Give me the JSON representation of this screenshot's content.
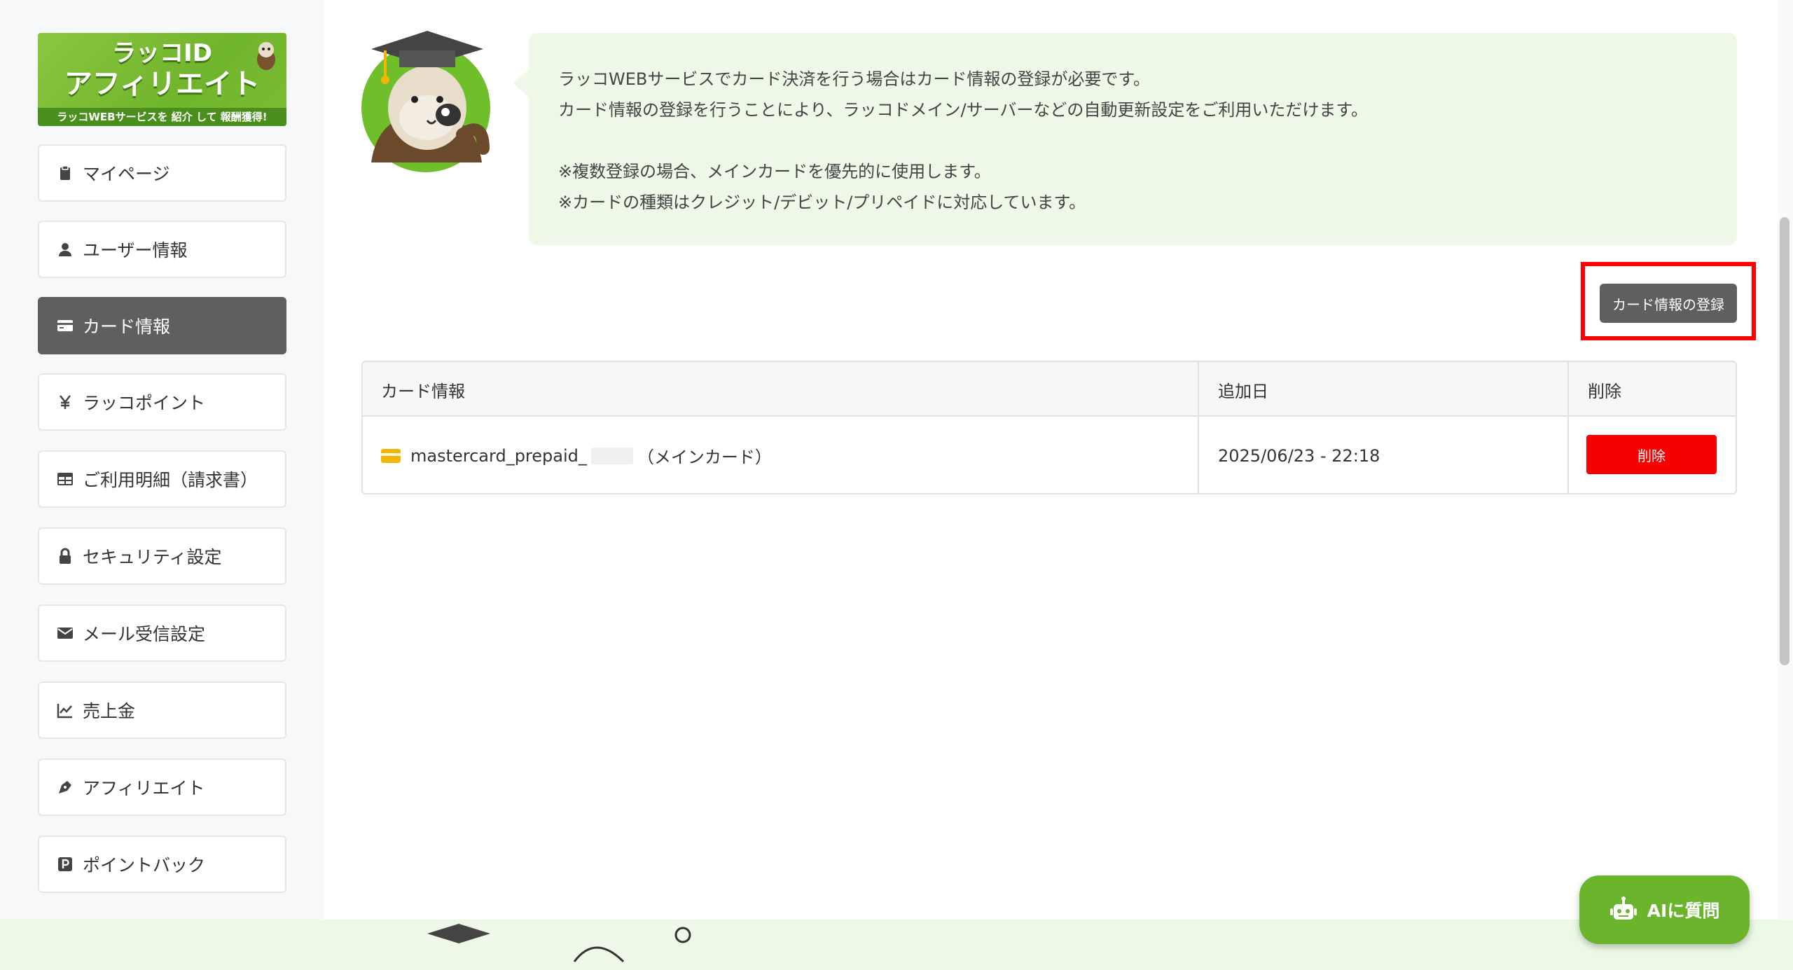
{
  "banner": {
    "line1": "ラッコID",
    "line2": "アフィリエイト",
    "tagline": "ラッコWEBサービスを 紹介 して 報酬獲得!"
  },
  "sidebar": {
    "items": [
      {
        "label": "マイページ",
        "icon": "clipboard-icon"
      },
      {
        "label": "ユーザー情報",
        "icon": "user-icon"
      },
      {
        "label": "カード情報",
        "icon": "credit-card-icon",
        "active": true
      },
      {
        "label": "ラッコポイント",
        "icon": "yen-icon"
      },
      {
        "label": "ご利用明細（請求書）",
        "icon": "table-icon"
      },
      {
        "label": "セキュリティ設定",
        "icon": "lock-icon"
      },
      {
        "label": "メール受信設定",
        "icon": "envelope-icon"
      },
      {
        "label": "売上金",
        "icon": "chart-line-icon"
      },
      {
        "label": "アフィリエイト",
        "icon": "pen-nib-icon"
      },
      {
        "label": "ポイントバック",
        "icon": "p-square-icon"
      }
    ]
  },
  "notice": {
    "line1": "ラッコWEBサービスでカード決済を行う場合はカード情報の登録が必要です。",
    "line2": "カード情報の登録を行うことにより、ラッコドメイン/サーバーなどの自動更新設定をご利用いただけます。",
    "line3": "※複数登録の場合、メインカードを優先的に使用します。",
    "line4": "※カードの種類はクレジット/デビット/プリペイドに対応しています。"
  },
  "actions": {
    "register_label": "カード情報の登録"
  },
  "table": {
    "headers": [
      "カード情報",
      "追加日",
      "削除"
    ],
    "rows": [
      {
        "card_name": "mastercard_prepaid_",
        "card_suffix": "（メインカード）",
        "added": "2025/06/23 - 22:18",
        "delete_label": "削除"
      }
    ]
  },
  "ai_button": {
    "label": "AIに質問"
  },
  "colors": {
    "accent_green": "#6bb52c",
    "active_nav": "#5f5f5f",
    "danger": "#f70000",
    "notice_bg": "#edf8e6"
  }
}
